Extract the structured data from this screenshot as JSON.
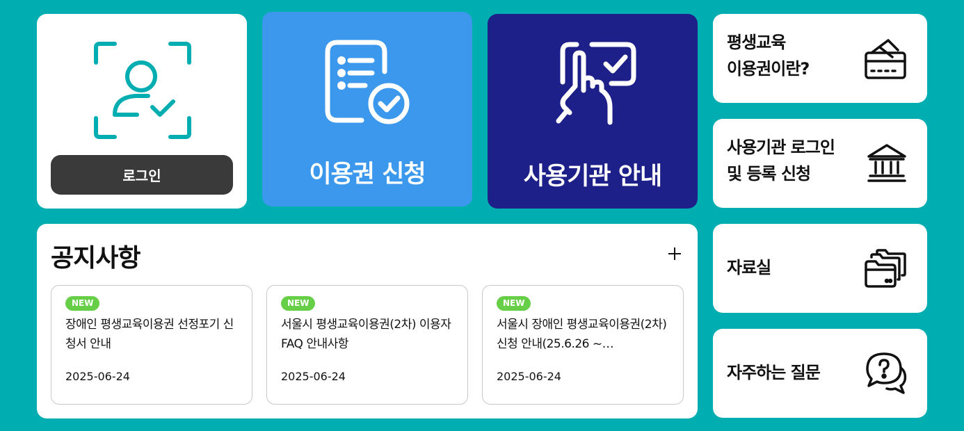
{
  "colors": {
    "background": "#00adb1",
    "apply_card": "#3b98ec",
    "institution_card": "#1e2089",
    "login_button": "#3a3a3a",
    "new_badge": "#67cf47",
    "icon_teal": "#00adb1"
  },
  "login": {
    "icon": "face-scan-user-check-icon",
    "button_label": "로그인"
  },
  "apply": {
    "icon": "document-check-icon",
    "label": "이용권 신청"
  },
  "institution": {
    "icon": "touch-screen-check-icon",
    "label": "사용기관 안내"
  },
  "side_menu": {
    "about": {
      "line1": "평생교육",
      "line2": "이용권이란?",
      "icon": "card-icon"
    },
    "institution_login": {
      "line1": "사용기관 로그인",
      "line2": "및 등록 신청",
      "icon": "bank-icon"
    },
    "archive": {
      "label": "자료실",
      "icon": "folder-icon"
    },
    "faq": {
      "label": "자주하는 질문",
      "icon": "question-chat-icon"
    }
  },
  "notices": {
    "title": "공지사항",
    "more_icon": "plus-icon",
    "items": [
      {
        "badge": "NEW",
        "text": "장애인 평생교육이용권 선정포기 신청서 안내",
        "date": "2025-06-24"
      },
      {
        "badge": "NEW",
        "text": "서울시 평생교육이용권(2차) 이용자 FAQ 안내사항",
        "date": "2025-06-24"
      },
      {
        "badge": "NEW",
        "text": "서울시 장애인 평생교육이용권(2차) 신청 안내(25.6.26 ~…",
        "date": "2025-06-24"
      }
    ]
  }
}
